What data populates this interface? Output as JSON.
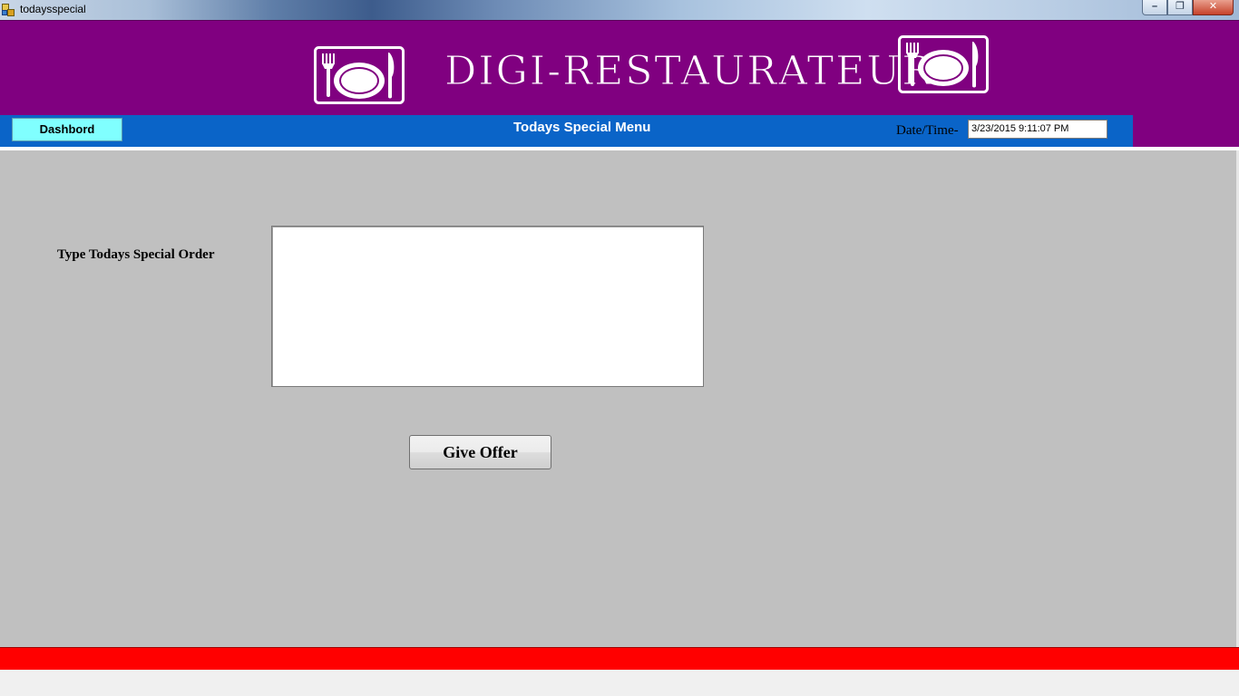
{
  "window": {
    "title": "todaysspecial",
    "minimize_glyph": "–",
    "restore_glyph": "❐",
    "close_glyph": "✕"
  },
  "header": {
    "brand": "DIGI-RESTAURATEUR",
    "logo_icon": "plate-fork-knife-icon",
    "background_color": "#800080"
  },
  "nav": {
    "dashboard_label": "Dashbord",
    "screen_title": "Todays Special Menu",
    "datetime_label": "Date/Time-",
    "datetime_value": "3/23/2015 9:11:07 PM",
    "strip_color": "#0a64c8"
  },
  "form": {
    "order_label": "Type Todays Special Order",
    "order_value": "",
    "submit_label": "Give Offer"
  },
  "colors": {
    "body": "#c0c0c0",
    "footer": "#ff0000",
    "dashboard_button": "#80ffff"
  }
}
